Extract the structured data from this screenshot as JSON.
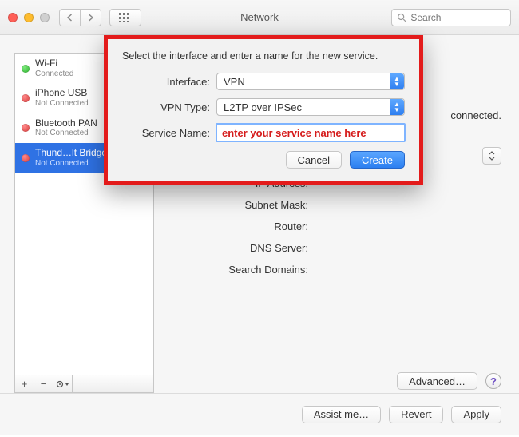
{
  "window": {
    "title": "Network",
    "search_placeholder": "Search"
  },
  "sidebar": {
    "items": [
      {
        "name": "Wi-Fi",
        "status": "Connected",
        "dot": "green",
        "selected": false
      },
      {
        "name": "iPhone USB",
        "status": "Not Connected",
        "dot": "red",
        "selected": false
      },
      {
        "name": "Bluetooth PAN",
        "status": "Not Connected",
        "dot": "red",
        "selected": false
      },
      {
        "name": "Thund…lt Bridge",
        "status": "Not Connected",
        "dot": "red",
        "selected": true
      }
    ],
    "footer": {
      "add": "+",
      "remove": "−",
      "gear": "✻▾"
    }
  },
  "content": {
    "status_line": "connected.",
    "fields": {
      "ip_address": "IP Address:",
      "subnet_mask": "Subnet Mask:",
      "router": "Router:",
      "dns_server": "DNS Server:",
      "search_domains": "Search Domains:"
    },
    "advanced_button": "Advanced…",
    "help": "?"
  },
  "bottombar": {
    "assist": "Assist me…",
    "revert": "Revert",
    "apply": "Apply"
  },
  "sheet": {
    "title": "Select the interface and enter a name for the new service.",
    "labels": {
      "interface": "Interface:",
      "vpn_type": "VPN Type:",
      "service_name": "Service Name:"
    },
    "values": {
      "interface": "VPN",
      "vpn_type": "L2TP over IPSec",
      "service_name": "enter your service name here"
    },
    "buttons": {
      "cancel": "Cancel",
      "create": "Create"
    }
  }
}
